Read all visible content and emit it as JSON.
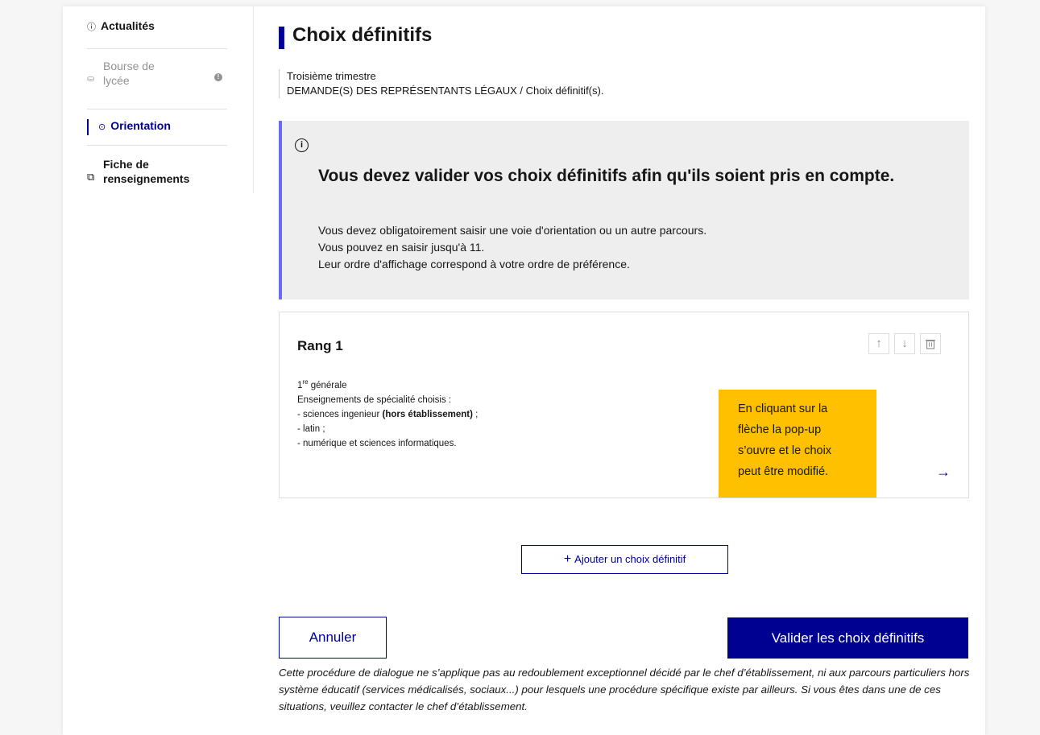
{
  "sidebar": {
    "items": [
      {
        "label": "Actualités",
        "icon": "info-circle-icon"
      },
      {
        "label": "Bourse de lycée",
        "icon": "coins-icon",
        "badge_icon": "info-dot-icon"
      },
      {
        "label": "Orientation",
        "icon": "compass-icon",
        "active": true
      },
      {
        "label": "Fiche de renseignements",
        "icon": "edit-file-icon"
      }
    ]
  },
  "main": {
    "title": "Choix définitifs",
    "breadcrumb": {
      "line1": "Troisième trimestre",
      "line2": "DEMANDE(S) DES REPRÉSENTANTS LÉGAUX / Choix définitif(s)."
    },
    "callout": {
      "icon": "info-circle-icon",
      "title": "Vous devez valider vos choix définitifs afin qu'ils soient pris en compte.",
      "lines": [
        "Vous devez obligatoirement saisir une voie d'orientation ou un autre parcours.",
        "Vous pouvez en saisir jusqu'à 11.",
        "Leur ordre d'affichage correspond à votre ordre de préférence."
      ]
    },
    "card": {
      "rank": "Rang 1",
      "level_prefix": "1",
      "level_sup": "re",
      "level_suffix": " générale",
      "specialties_heading": "Enseignements de spécialité choisis :",
      "spec1_prefix": "- sciences ingenieur ",
      "spec1_bold": "(hors établissement)",
      "spec1_suffix": " ;",
      "spec2": "- latin ;",
      "spec3": "- numérique et sciences informatiques.",
      "actions": {
        "up": "↑",
        "down": "↓",
        "delete": "🗑"
      },
      "arrow": "→"
    },
    "sticky_note": [
      "En cliquant sur la",
      "flèche la pop-up",
      "s’ouvre et le choix",
      "peut être modifié."
    ],
    "add_button": {
      "plus": "+",
      "label": "Ajouter un choix définitif"
    },
    "cancel_button": "Annuler",
    "validate_button": "Valider les choix définitifs",
    "footnote": "Cette procédure de dialogue ne s’applique pas au redoublement exceptionnel décidé par le chef d’établissement, ni aux parcours particuliers hors système éducatif (services médicalisés, sociaux...) pour lesquels une procédure spécifique existe par ailleurs. Si vous êtes dans une de ces situations, veuillez contacter le chef d’établissement."
  },
  "colors": {
    "primary": "#000091",
    "callout_accent": "#6a6af4",
    "sticky": "#ffc000",
    "disabled": "#929292"
  }
}
